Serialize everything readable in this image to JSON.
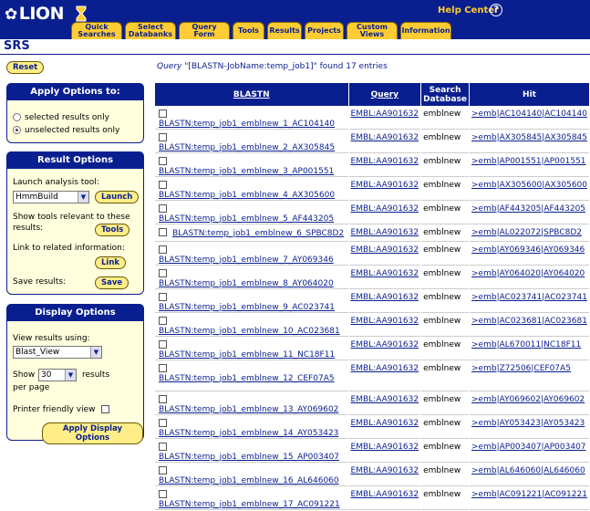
{
  "header": {
    "logo": "LION",
    "help_center": "Help Center",
    "help_icon": "?",
    "tabs": [
      "Quick\nSearches",
      "Select\nDatabanks",
      "Query\nForm",
      "Tools",
      "Results",
      "Projects",
      "Custom\nViews",
      "Information"
    ]
  },
  "app": {
    "title": "SRS",
    "reset": "Reset"
  },
  "apply_panel": {
    "title": "Apply Options to:",
    "opt1": "selected results only",
    "opt2": "unselected results only"
  },
  "result_options": {
    "title": "Result Options",
    "launch_label": "Launch analysis tool:",
    "tool_value": "HmmBuild",
    "launch_btn": "Launch",
    "show_tools_label": "Show tools relevant to these results:",
    "tools_btn": "Tools",
    "link_label": "Link to related information:",
    "link_btn": "Link",
    "save_label": "Save results:",
    "save_btn": "Save"
  },
  "display_options": {
    "title": "Display Options",
    "view_label": "View results using:",
    "view_value": "Blast_View",
    "show_label": "Show",
    "show_value": "30",
    "results_label": "results",
    "per_page": "per page",
    "printer": "Printer friendly view",
    "apply_btn": "Apply Display Options"
  },
  "query": {
    "prefix": "Query",
    "text": "\"[BLASTN-JobName:temp_job1]\" found 17 entries"
  },
  "table": {
    "headers": [
      "BLASTN",
      "Query",
      "Search\nDatabase",
      "Hit"
    ],
    "rows": [
      {
        "name": "BLASTN:temp_job1_emblnew_1_AC104140",
        "query": "EMBL:AA901632",
        "db": "emblnew",
        "hit": ">emb|AC104140|AC104140"
      },
      {
        "name": "BLASTN:temp_job1_emblnew_2_AX305845",
        "query": "EMBL:AA901632",
        "db": "emblnew",
        "hit": ">emb|AX305845|AX305845"
      },
      {
        "name": "BLASTN:temp_job1_emblnew_3_AP001551",
        "query": "EMBL:AA901632",
        "db": "emblnew",
        "hit": ">emb|AP001551|AP001551"
      },
      {
        "name": "BLASTN:temp_job1_emblnew_4_AX305600",
        "query": "EMBL:AA901632",
        "db": "emblnew",
        "hit": ">emb|AX305600|AX305600"
      },
      {
        "name": "BLASTN:temp_job1_emblnew_5_AF443205",
        "query": "EMBL:AA901632",
        "db": "emblnew",
        "hit": ">emb|AF443205|AF443205"
      },
      {
        "name": "BLASTN:temp_job1_emblnew_6_SPBC8D2",
        "query": "EMBL:AA901632",
        "db": "emblnew",
        "hit": ">emb|AL022072|SPBC8D2"
      },
      {
        "name": "BLASTN:temp_job1_emblnew_7_AY069346",
        "query": "EMBL:AA901632",
        "db": "emblnew",
        "hit": ">emb|AY069346|AY069346"
      },
      {
        "name": "BLASTN:temp_job1_emblnew_8_AY064020",
        "query": "EMBL:AA901632",
        "db": "emblnew",
        "hit": ">emb|AY064020|AY064020"
      },
      {
        "name": "BLASTN:temp_job1_emblnew_9_AC023741",
        "query": "EMBL:AA901632",
        "db": "emblnew",
        "hit": ">emb|AC023741|AC023741"
      },
      {
        "name": "BLASTN:temp_job1_emblnew_10_AC023681",
        "query": "EMBL:AA901632",
        "db": "emblnew",
        "hit": ">emb|AC023681|AC023681"
      },
      {
        "name": "BLASTN:temp_job1_emblnew_11_NC18F11",
        "query": "EMBL:AA901632",
        "db": "emblnew",
        "hit": ">emb|AL670011|NC18F11"
      },
      {
        "name": "BLASTN:temp_job1_emblnew_12_CEF07A5",
        "query": "EMBL:AA901632",
        "db": "emblnew",
        "hit": ">emb|Z72506|CEF07A5"
      },
      {
        "name": "BLASTN:temp_job1_emblnew_13_AY069602",
        "query": "EMBL:AA901632",
        "db": "emblnew",
        "hit": ">emb|AY069602|AY069602"
      },
      {
        "name": "BLASTN:temp_job1_emblnew_14_AY053423",
        "query": "EMBL:AA901632",
        "db": "emblnew",
        "hit": ">emb|AY053423|AY053423"
      },
      {
        "name": "BLASTN:temp_job1_emblnew_15_AP003407",
        "query": "EMBL:AA901632",
        "db": "emblnew",
        "hit": ">emb|AP003407|AP003407"
      },
      {
        "name": "BLASTN:temp_job1_emblnew_16_AL646060",
        "query": "EMBL:AA901632",
        "db": "emblnew",
        "hit": ">emb|AL646060|AL646060"
      },
      {
        "name": "BLASTN:temp_job1_emblnew_17_AC091221",
        "query": "EMBL:AA901632",
        "db": "emblnew",
        "hit": ">emb|AC091221|AC091221"
      }
    ]
  },
  "colors": {
    "navy": "#0a1f8f",
    "gold": "#ffcc33",
    "panel_bg": "#ffffdd"
  }
}
